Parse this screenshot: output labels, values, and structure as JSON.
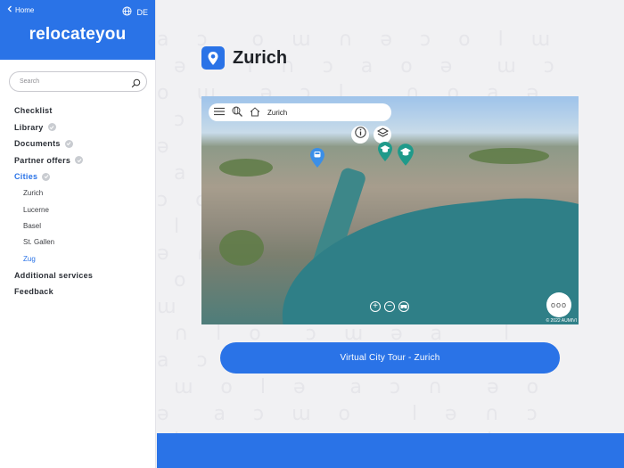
{
  "header": {
    "back_label": "Home",
    "language": "DE",
    "logo": "relocateyou"
  },
  "search": {
    "placeholder": "Search"
  },
  "menu": [
    {
      "label": "Checklist",
      "checked": false
    },
    {
      "label": "Library",
      "checked": true
    },
    {
      "label": "Documents",
      "checked": true
    },
    {
      "label": "Partner offers",
      "checked": true
    },
    {
      "label": "Cities",
      "checked": true,
      "active": true
    }
  ],
  "cities": [
    "Zurich",
    "Lucerne",
    "Basel",
    "St. Gallen",
    "Zug"
  ],
  "active_city_index": 4,
  "menu_bottom": [
    {
      "label": "Additional services"
    },
    {
      "label": "Feedback"
    }
  ],
  "page": {
    "title": "Zurich"
  },
  "map": {
    "location_label": "Zurich",
    "copyright": "© 2022 AUMIVI"
  },
  "cta": {
    "label": "Virtual City Tour - Zurich"
  },
  "colors": {
    "brand": "#2a73e7",
    "pin_teal": "#1f9a8a",
    "pin_blue": "#3b8fe8"
  }
}
